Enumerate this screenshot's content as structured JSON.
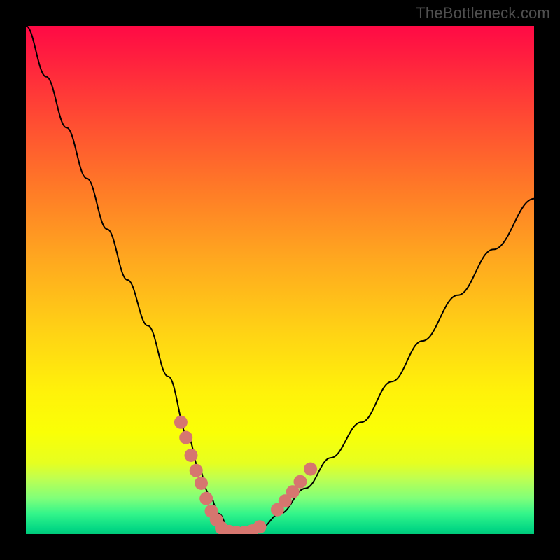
{
  "watermark": "TheBottleneck.com",
  "colors": {
    "curve_stroke": "#000000",
    "marker_fill": "#d6766f",
    "frame_bg": "#000000"
  },
  "chart_data": {
    "type": "line",
    "title": "",
    "xlabel": "",
    "ylabel": "",
    "xlim": [
      0,
      100
    ],
    "ylim": [
      0,
      100
    ],
    "grid": false,
    "legend": false,
    "series": [
      {
        "name": "bottleneck-curve",
        "x": [
          0,
          4,
          8,
          12,
          16,
          20,
          24,
          28,
          32,
          34,
          36,
          38,
          40,
          42,
          44,
          46,
          50,
          55,
          60,
          66,
          72,
          78,
          85,
          92,
          100
        ],
        "y": [
          100,
          90,
          80,
          70,
          60,
          50,
          41,
          31,
          19,
          13,
          8,
          4,
          1,
          0,
          0,
          1,
          4,
          9,
          15,
          22,
          30,
          38,
          47,
          56,
          66
        ]
      }
    ],
    "marker_clusters": [
      {
        "name": "left-descent-markers",
        "points": [
          {
            "x": 30.5,
            "y": 22
          },
          {
            "x": 31.5,
            "y": 19
          },
          {
            "x": 32.5,
            "y": 15.5
          },
          {
            "x": 33.5,
            "y": 12.5
          },
          {
            "x": 34.5,
            "y": 10
          },
          {
            "x": 35.5,
            "y": 7
          },
          {
            "x": 36.5,
            "y": 4.5
          },
          {
            "x": 37.5,
            "y": 2.8
          }
        ]
      },
      {
        "name": "valley-markers",
        "points": [
          {
            "x": 38.5,
            "y": 1.2
          },
          {
            "x": 40.0,
            "y": 0.5
          },
          {
            "x": 41.5,
            "y": 0.3
          },
          {
            "x": 43.0,
            "y": 0.3
          },
          {
            "x": 44.5,
            "y": 0.6
          },
          {
            "x": 46.0,
            "y": 1.4
          }
        ]
      },
      {
        "name": "right-ascent-markers",
        "points": [
          {
            "x": 49.5,
            "y": 4.8
          },
          {
            "x": 51.0,
            "y": 6.5
          },
          {
            "x": 52.5,
            "y": 8.3
          },
          {
            "x": 54.0,
            "y": 10.3
          },
          {
            "x": 56.0,
            "y": 12.8
          }
        ]
      }
    ]
  }
}
